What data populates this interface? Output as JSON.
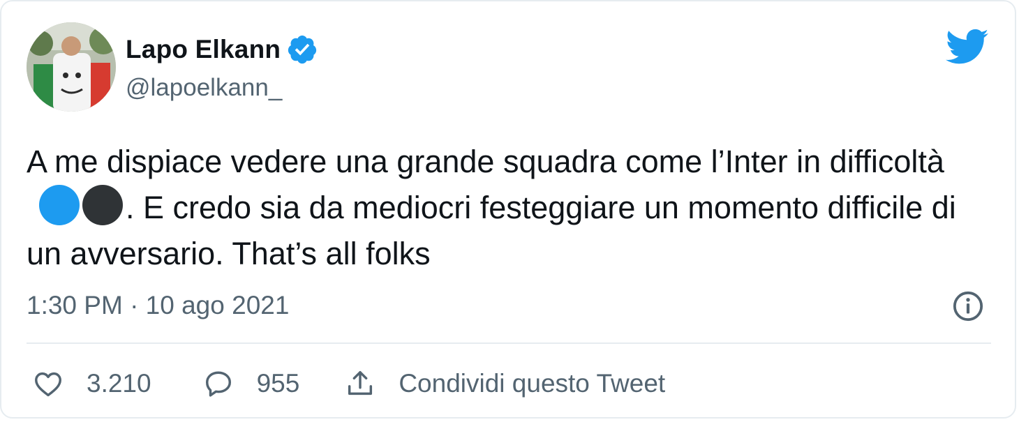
{
  "tweet": {
    "author_name": "Lapo Elkann",
    "handle": "@lapoelkann_",
    "text_part1": "A me dispiace vedere una grande squadra come l’Inter in difficoltà",
    "text_part2": ".  E credo sia da mediocri festeggiare un momento difficile di un avversario. That’s all folks",
    "emoji_names": [
      "blue-circle",
      "black-circle"
    ],
    "timestamp": "1:30 PM · 10 ago 2021",
    "likes": "3.210",
    "replies": "955",
    "share_label": "Condividi questo Tweet"
  },
  "colors": {
    "brand_blue": "#1d9bf0",
    "text_primary": "#0f1419",
    "text_secondary": "#536471",
    "divider": "#e6ecf0"
  }
}
